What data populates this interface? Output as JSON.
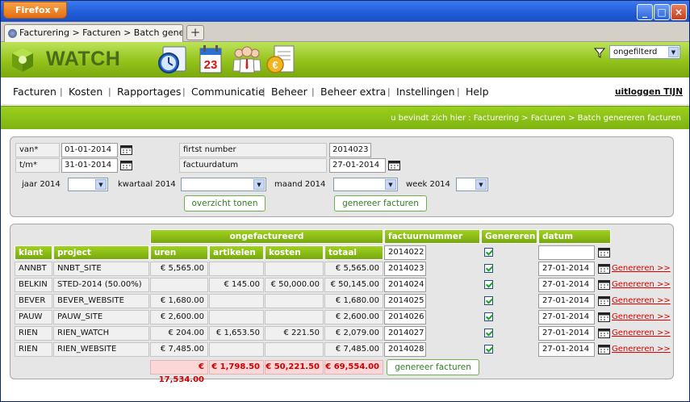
{
  "browser": {
    "menu_button": "Firefox",
    "tab_title": "Facturering > Facturen > Batch genereren f...",
    "new_tab": "+",
    "window_buttons": {
      "minimize": "_",
      "maximize": "□",
      "close": "×"
    }
  },
  "app": {
    "brand": "WATCH",
    "header_icons": [
      "clock-icon",
      "calendar-icon",
      "users-icon",
      "invoice-icon"
    ],
    "calendar_day": "23",
    "filter": {
      "selected": "ongefilterd"
    },
    "nav": [
      "Facturen",
      "Kosten",
      "Rapportages",
      "Communicatie",
      "Beheer",
      "Beheer extra",
      "Instellingen",
      "Help"
    ],
    "nav_separator": "|",
    "logout": "uitloggen TIJN",
    "breadcrumb": "u bevindt zich hier : Facturering > Facturen > Batch genereren facturen",
    "colors": {
      "accent": "#8cc218",
      "link": "#dd0000",
      "total_bg": "#fbd7d7"
    }
  },
  "form": {
    "van_label": "van*",
    "van_value": "01-01-2014",
    "tm_label": "t/m*",
    "tm_value": "31-01-2014",
    "first_number_label": "firtst number",
    "first_number_value": "2014023",
    "factuurdatum_label": "factuurdatum",
    "factuurdatum_value": "27-01-2014",
    "jaar_label": "jaar 2014",
    "kwartaal_label": "kwartaal 2014",
    "maand_label": "maand 2014",
    "week_label": "week 2014",
    "overview_button": "overzicht tonen",
    "generate_button": "genereer facturen"
  },
  "table": {
    "group_header": "ongefactureerd",
    "headers": {
      "klant": "klant",
      "project": "project",
      "uren": "uren",
      "artikelen": "artikelen",
      "kosten": "kosten",
      "totaal": "totaal",
      "factuurnummer": "factuurnummer",
      "genereren": "Genereren",
      "datum": "datum"
    },
    "first_factuurnummer": "2014022",
    "rows": [
      {
        "klant": "ANNBT",
        "project": "NNBT_SITE",
        "uren": "€ 5,565.00",
        "artikelen": "",
        "kosten": "",
        "totaal": "€ 5,565.00",
        "factuurnummer": "2014023",
        "checked": true,
        "datum": "27-01-2014",
        "link": "Genereren >>"
      },
      {
        "klant": "BELKIN",
        "project": "STED-2014 (50.00%)",
        "uren": "",
        "artikelen": "€ 145.00",
        "kosten": "€ 50,000.00",
        "totaal": "€ 50,145.00",
        "factuurnummer": "2014024",
        "checked": true,
        "datum": "27-01-2014",
        "link": "Genereren >>"
      },
      {
        "klant": "BEVER",
        "project": "BEVER_WEBSITE",
        "uren": "€ 1,680.00",
        "artikelen": "",
        "kosten": "",
        "totaal": "€ 1,680.00",
        "factuurnummer": "2014025",
        "checked": true,
        "datum": "27-01-2014",
        "link": "Genereren >>"
      },
      {
        "klant": "PAUW",
        "project": "PAUW_SITE",
        "uren": "€ 2,600.00",
        "artikelen": "",
        "kosten": "",
        "totaal": "€ 2,600.00",
        "factuurnummer": "2014026",
        "checked": true,
        "datum": "27-01-2014",
        "link": "Genereren >>"
      },
      {
        "klant": "RIEN",
        "project": "RIEN_WATCH",
        "uren": "€ 204.00",
        "artikelen": "€ 1,653.50",
        "kosten": "€ 221.50",
        "totaal": "€ 2,079.00",
        "factuurnummer": "2014027",
        "checked": true,
        "datum": "27-01-2014",
        "link": "Genereren >>"
      },
      {
        "klant": "RIEN",
        "project": "RIEN_WEBSITE",
        "uren": "€ 7,485.00",
        "artikelen": "",
        "kosten": "",
        "totaal": "€ 7,485.00",
        "factuurnummer": "2014028",
        "checked": true,
        "datum": "27-01-2014",
        "link": "Genereren >>"
      }
    ],
    "totals": {
      "uren": "€ 17,534.00",
      "artikelen": "€ 1,798.50",
      "kosten": "€ 50,221.50",
      "totaal": "€ 69,554.00"
    },
    "generate_button": "genereer facturen"
  }
}
